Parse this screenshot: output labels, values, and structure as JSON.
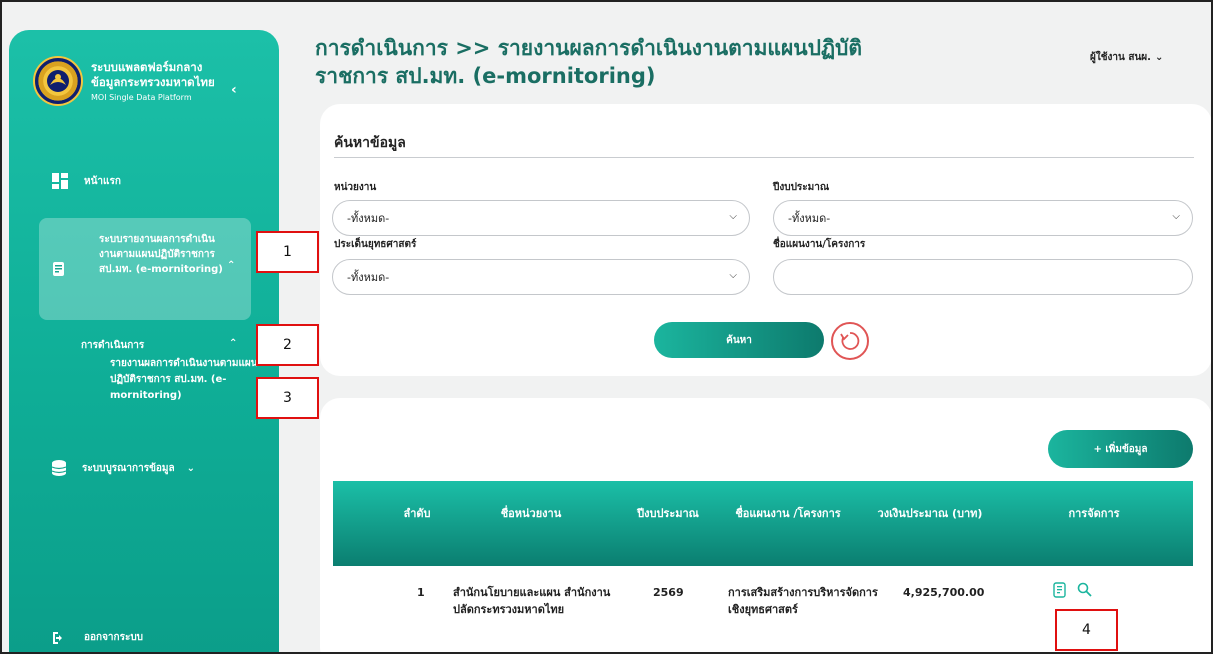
{
  "brand": {
    "line1": "ระบบแพลตฟอร์มกลาง",
    "line2": "ข้อมูลกระทรวงมหาดไทย",
    "sub": "MOI Single Data Platform"
  },
  "sidebar": {
    "home": "หน้าแรก",
    "report_system": "ระบบรายงานผลการดำเนินงานตามแผนปฏิบัติราชการ สป.มท. (e-mornitoring)",
    "operations": "การดำเนินการ",
    "report_item": "รายงานผลการดำเนินงานตามแผนปฏิบัติราชการ สป.มท. (e-mornitoring)",
    "integration": "ระบบบูรณาการข้อมูล",
    "logout": "ออกจากระบบ"
  },
  "header": {
    "title": "การดำเนินการ >> รายงานผลการดำเนินงานตามแผนปฏิบัติราชการ สป.มท. (e-mornitoring)",
    "user": "ผู้ใช้งาน สนผ."
  },
  "search": {
    "title": "ค้นหาข้อมูล",
    "agency_label": "หน่วยงาน",
    "agency_value": "-ทั้งหมด-",
    "year_label": "ปีงบประมาณ",
    "year_value": "-ทั้งหมด-",
    "strategy_label": "ประเด็นยุทธศาสตร์",
    "strategy_value": "-ทั้งหมด-",
    "plan_label": "ชื่อแผนงาน/โครงการ",
    "plan_value": "",
    "search_button": "ค้นหา"
  },
  "table": {
    "add_button": "+ เพิ่มข้อมูล",
    "headers": {
      "no": "ลำดับ",
      "agency": "ชื่อหน่วยงาน",
      "year": "ปีงบประมาณ",
      "plan": "ชื่อแผนงาน /โครงการ",
      "budget": "วงเงินประมาณ (บาท)",
      "manage": "การจัดการ"
    },
    "rows": [
      {
        "no": "1",
        "agency": "สำนักนโยบายและแผน สำนักงานปลัดกระทรวงมหาดไทย",
        "year": "2569",
        "plan": "การเสริมสร้างการบริหารจัดการเชิงยุทธศาสตร์",
        "budget": "4,925,700.00"
      }
    ]
  },
  "annotations": [
    "1",
    "2",
    "3",
    "4"
  ],
  "colors": {
    "accent": "#1bb59e",
    "accent_dark": "#0d7a6d",
    "title": "#1a6e63",
    "annotation": "#e01010"
  },
  "icons": {
    "home": "dashboard-icon",
    "report": "report-icon",
    "database": "database-icon",
    "logout": "logout-icon",
    "reset": "refresh-icon",
    "detail": "document-icon",
    "view": "search-icon"
  }
}
